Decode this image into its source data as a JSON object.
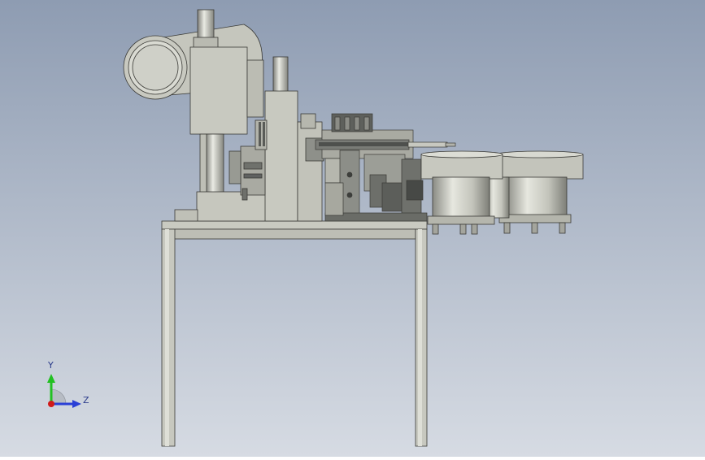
{
  "viewport": {
    "background_top": "#8e9cb2",
    "background_bottom": "#d6dbe3",
    "model_color": "#c8c9c0",
    "edge_color": "#3a3a36"
  },
  "triad": {
    "y_label": "Y",
    "z_label": "Z",
    "y_axis_color": "#22c022",
    "z_axis_color": "#2a3fd6",
    "x_axis_color": "#d01a1a"
  }
}
